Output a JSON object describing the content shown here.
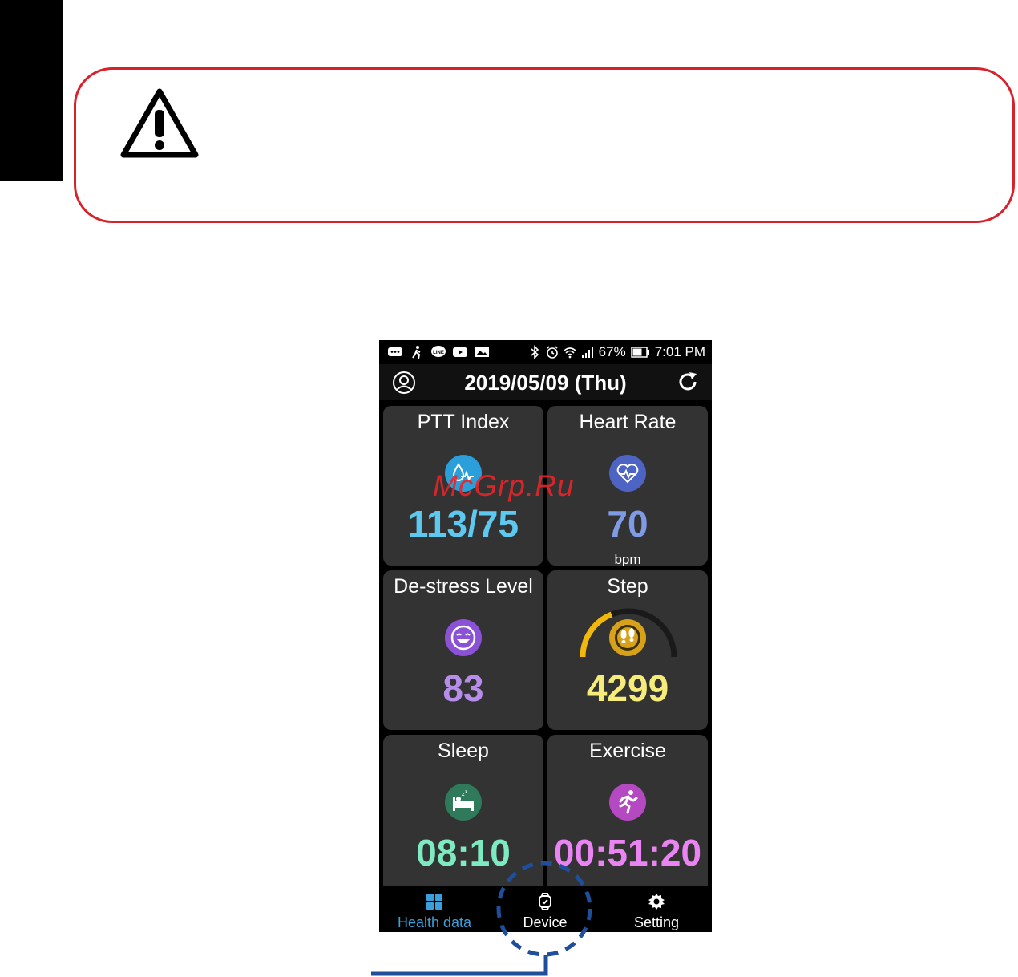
{
  "status_bar": {
    "battery": "67%",
    "time": "7:01 PM",
    "left_icons": [
      "chat-icon",
      "walk-icon",
      "line-icon",
      "youtube-icon",
      "gallery-icon"
    ],
    "right_icons": [
      "bluetooth-icon",
      "alarm-icon",
      "wifi-icon",
      "signal-icon",
      "battery-icon"
    ]
  },
  "app_bar": {
    "date": "2019/05/09 (Thu)"
  },
  "cards": [
    {
      "title": "PTT Index",
      "value": "113/75",
      "unit": "",
      "icon": "heart-drop-icon",
      "color": "#5ec9f0",
      "icon_bg": "#2b9fd9"
    },
    {
      "title": "Heart Rate",
      "value": "70",
      "unit": "bpm",
      "icon": "heart-pulse-icon",
      "color": "#7f9be6",
      "icon_bg": "#4d64c4"
    },
    {
      "title": "De-stress Level",
      "value": "83",
      "unit": "",
      "icon": "smile-icon",
      "color": "#b68ee9",
      "icon_bg": "#8c52d6"
    },
    {
      "title": "Step",
      "value": "4299",
      "unit": "",
      "icon": "footsteps-icon",
      "color": "#f5ec7a",
      "icon_bg": "#d8a11a",
      "progress": 0.38
    },
    {
      "title": "Sleep",
      "value": "08:10",
      "unit": "",
      "icon": "bed-icon",
      "color": "#7eeac1",
      "icon_bg": "#2f7a5a"
    },
    {
      "title": "Exercise",
      "value": "00:51:20",
      "unit": "",
      "icon": "runner-icon",
      "color": "#e984f2",
      "icon_bg": "#b449c2"
    }
  ],
  "nav": {
    "items": [
      {
        "label": "Health data",
        "icon": "grid-icon",
        "active": true
      },
      {
        "label": "Device",
        "icon": "watch-icon",
        "active": false
      },
      {
        "label": "Setting",
        "icon": "gear-icon",
        "active": false
      }
    ],
    "active_color": "#3aa0dc"
  },
  "watermark": "McGrp.Ru",
  "colors": {
    "warning_border": "#d7222b",
    "callout_blue": "#1f4e9b"
  }
}
